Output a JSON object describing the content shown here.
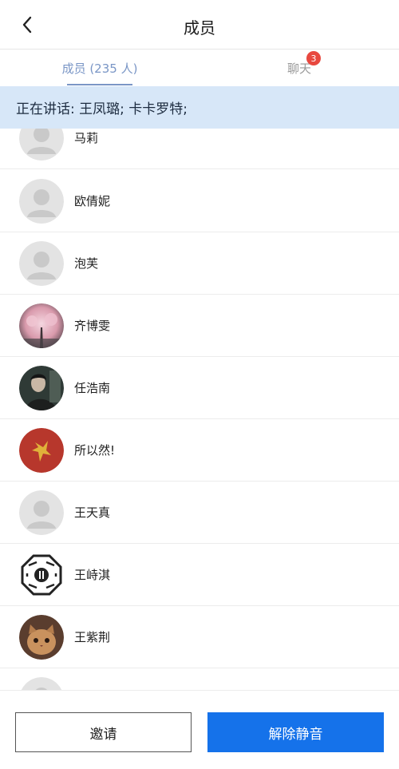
{
  "header": {
    "title": "成员"
  },
  "tabs": {
    "members_label": "成员 (235 人)",
    "chat_label": "聊天",
    "chat_badge": "3"
  },
  "speaking": {
    "text": "正在讲话: 王凤璐; 卡卡罗特;"
  },
  "members": [
    {
      "name": "马莉",
      "avatar": "default-avatar"
    },
    {
      "name": "欧倩妮",
      "avatar": "default-avatar"
    },
    {
      "name": "泡芙",
      "avatar": "default-avatar"
    },
    {
      "name": "齐博雯",
      "avatar": "photo-avatar"
    },
    {
      "name": "任浩南",
      "avatar": "photo-avatar"
    },
    {
      "name": "所以然!",
      "avatar": "photo-avatar"
    },
    {
      "name": "王天真",
      "avatar": "default-avatar"
    },
    {
      "name": "王峙淇",
      "avatar": "photo-avatar"
    },
    {
      "name": "王紫荆",
      "avatar": "photo-avatar"
    },
    {
      "name": "",
      "avatar": "default-avatar"
    }
  ],
  "footer": {
    "invite_label": "邀请",
    "unmute_label": "解除静音"
  },
  "colors": {
    "accent": "#7a96c6",
    "badge": "#e8483f",
    "speaking_bg": "#d7e7f8",
    "primary_button": "#1572ea"
  }
}
